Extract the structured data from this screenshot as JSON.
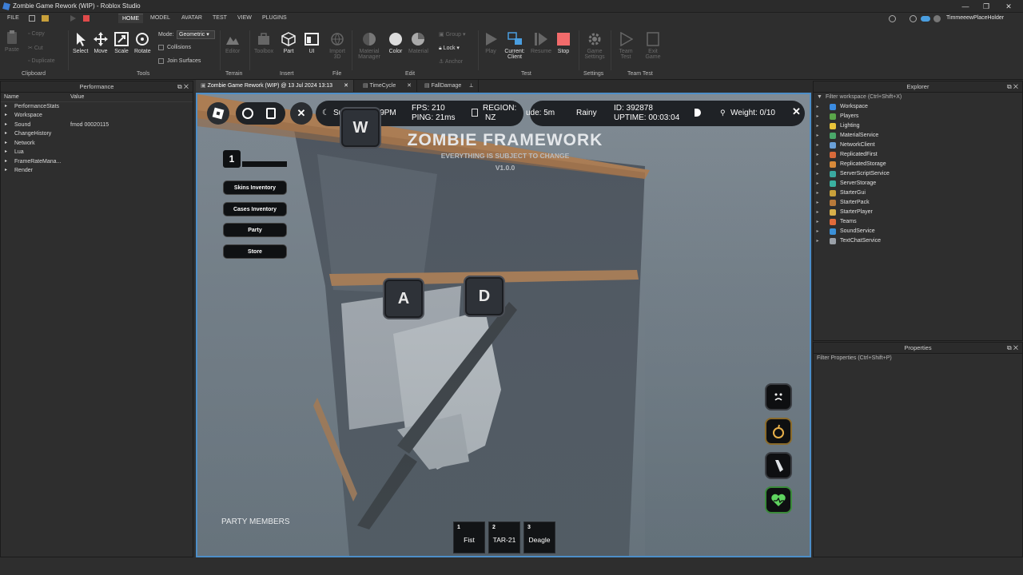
{
  "window": {
    "title": "Zombie Game Rework (WIP) - Roblox Studio",
    "minimize": "—",
    "maximize": "❐",
    "close": "✕"
  },
  "menu": {
    "file": "FILE",
    "tabs": [
      "HOME",
      "MODEL",
      "AVATAR",
      "TEST",
      "VIEW",
      "PLUGINS"
    ],
    "user": "TimmeeewPlaceHolder"
  },
  "ribbon": {
    "clipboard": {
      "paste": "Paste",
      "copy": "Copy",
      "cut": "Cut",
      "duplicate": "Duplicate",
      "group": "Clipboard"
    },
    "tools": {
      "select": "Select",
      "move": "Move",
      "scale": "Scale",
      "rotate": "Rotate",
      "mode_label": "Mode:",
      "mode_value": "Geometric",
      "collisions": "Collisions",
      "join": "Join Surfaces",
      "group": "Tools"
    },
    "terrain": {
      "editor": "Editor",
      "group": "Terrain"
    },
    "insert": {
      "toolbox": "Toolbox",
      "part": "Part",
      "ui": "UI",
      "group": "Insert"
    },
    "file": {
      "import": "Import 3D",
      "group": "File"
    },
    "edit": {
      "material_manager": "Material Manager",
      "color": "Color",
      "material": "Material",
      "group_btn": "Group",
      "lock": "Lock",
      "anchor": "Anchor",
      "group": "Edit"
    },
    "test": {
      "play": "Play",
      "current": "Current: Client",
      "resume": "Resume",
      "stop": "Stop",
      "group": "Test"
    },
    "settings": {
      "game_settings": "Game Settings",
      "group": "Settings"
    },
    "team": {
      "team_test": "Team Test",
      "exit_game": "Exit Game",
      "group": "Team Test"
    }
  },
  "performance": {
    "title": "Performance",
    "col_name": "Name",
    "col_value": "Value",
    "rows": [
      {
        "name": "PerformanceStats",
        "value": ""
      },
      {
        "name": "Workspace",
        "value": ""
      },
      {
        "name": "Sound",
        "value": "fmod 00020115"
      },
      {
        "name": "ChangeHistory",
        "value": ""
      },
      {
        "name": "Network",
        "value": ""
      },
      {
        "name": "Lua",
        "value": ""
      },
      {
        "name": "FrameRateMana...",
        "value": ""
      },
      {
        "name": "Render",
        "value": ""
      }
    ]
  },
  "doctabs": [
    {
      "label": "Zombie Game Rework (WIP) @ 13 Jul 2024 13:13"
    },
    {
      "label": "TimeCycle"
    },
    {
      "label": "FallDamage"
    }
  ],
  "explorer": {
    "title": "Explorer",
    "filter": "Filter workspace (Ctrl+Shift+X)",
    "items": [
      {
        "label": "Workspace",
        "color": "#3b8be0"
      },
      {
        "label": "Players",
        "color": "#5aa64a"
      },
      {
        "label": "Lighting",
        "color": "#e8c33a"
      },
      {
        "label": "MaterialService",
        "color": "#4aa86a"
      },
      {
        "label": "NetworkClient",
        "color": "#6aa0d8"
      },
      {
        "label": "ReplicatedFirst",
        "color": "#d86a3a"
      },
      {
        "label": "ReplicatedStorage",
        "color": "#d88a3a"
      },
      {
        "label": "ServerScriptService",
        "color": "#3aa8a0"
      },
      {
        "label": "ServerStorage",
        "color": "#3ab0a0"
      },
      {
        "label": "StarterGui",
        "color": "#c8a03a"
      },
      {
        "label": "StarterPack",
        "color": "#b87a3a"
      },
      {
        "label": "StarterPlayer",
        "color": "#d8b04a"
      },
      {
        "label": "Teams",
        "color": "#e06a3a"
      },
      {
        "label": "SoundService",
        "color": "#3a90d8"
      },
      {
        "label": "TextChatService",
        "color": "#9aa0a8"
      }
    ]
  },
  "properties": {
    "title": "Properties",
    "filter": "Filter Properties (Ctrl+Shift+P)"
  },
  "game": {
    "time": "Sunday, 12:29PM",
    "fps": "FPS: 210",
    "ping": "PING: 21ms",
    "region_label": "REGION:",
    "region": "NZ",
    "altitude": "ude: 5m",
    "weather": "Rainy",
    "id": "ID: 392878",
    "uptime": "UPTIME: 00:03:04",
    "weight": "Weight: 0/10",
    "title": "ZOMBIE FRAMEWORK",
    "subtitle": "EVERYTHING IS SUBJECT TO CHANGE",
    "version": "V1.0.0",
    "level": "1",
    "menu_buttons": [
      "Skins Inventory",
      "Cases Inventory",
      "Party",
      "Store"
    ],
    "keys": {
      "w": "W",
      "a": "A",
      "d": "D"
    },
    "party_members": "PARTY MEMBERS",
    "hotbar": [
      {
        "n": "1",
        "label": "Fist"
      },
      {
        "n": "2",
        "label": "TAR-21"
      },
      {
        "n": "3",
        "label": "Deagle"
      }
    ],
    "close": "✕"
  }
}
